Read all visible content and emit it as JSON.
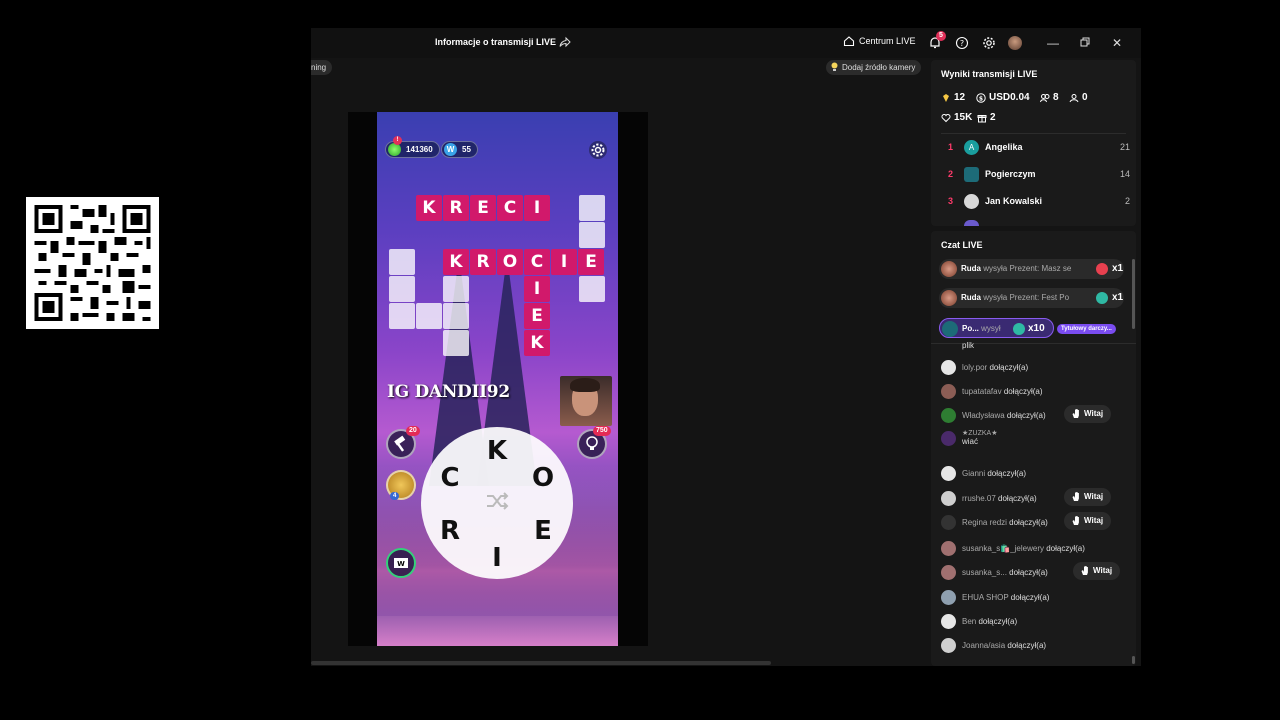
{
  "titlebar": {
    "title": "Informacje o transmisji LIVE",
    "centrum": "Centrum LIVE",
    "notif_count": "5"
  },
  "toolbar": {
    "left_pill": "ning",
    "add_camera": "Dodaj źródło kamery"
  },
  "game": {
    "coins": "141360",
    "w_points": "55",
    "hud_notif": "!",
    "watermark": "IG DANDII92",
    "words": {
      "kreci": [
        "K",
        "R",
        "E",
        "C",
        "I"
      ],
      "krocie": [
        "K",
        "R",
        "O",
        "C",
        "I",
        "E"
      ],
      "vertical": [
        "I",
        "E",
        "K"
      ]
    },
    "hammer_count": "20",
    "hint_count": "750",
    "gift_small": "4",
    "wheel_letters": [
      "K",
      "O",
      "E",
      "I",
      "R",
      "C"
    ]
  },
  "results": {
    "title": "Wyniki transmisji LIVE",
    "diamonds": "12",
    "usd": "USD0.04",
    "viewers": "8",
    "followers": "0",
    "likes": "15K",
    "gifts": "2",
    "ranking": [
      {
        "rank": "1",
        "name": "Angelika",
        "score": "21",
        "initial": "A"
      },
      {
        "rank": "2",
        "name": "Pogierczym",
        "score": "14",
        "initial": ""
      },
      {
        "rank": "3",
        "name": "Jan Kowalski",
        "score": "2",
        "initial": ""
      }
    ]
  },
  "chat": {
    "title": "Czat LIVE",
    "gifts": [
      {
        "user": "Ruda",
        "text": "wysyła Prezent: Masz se",
        "mult": "x1"
      },
      {
        "user": "Ruda",
        "text": "wysyła Prezent: Fest Po",
        "mult": "x1"
      },
      {
        "user": "Po...",
        "text": "wysył",
        "mult": "x10",
        "tag": "Tytułowy darczy..."
      }
    ],
    "messages": [
      {
        "user": "",
        "text": "plik"
      },
      {
        "user": "loly.por",
        "text": "dołączył(a)"
      },
      {
        "user": "tupatatafav",
        "text": "dołączył(a)"
      },
      {
        "user": "Władysława",
        "text": "dołączył(a)",
        "witaj": "Witaj"
      },
      {
        "user": "★ZUZKA★",
        "text": "wiać"
      },
      {
        "user": "Gianni",
        "text": "dołączył(a)"
      },
      {
        "user": "rrushe.07",
        "text": "dołączył(a)",
        "witaj": "Witaj"
      },
      {
        "user": "Regina redzi",
        "text": "dołączył(a)",
        "witaj": "Witaj"
      },
      {
        "user": "susanka_s🛍️_jelewery",
        "text": "dołączył(a)"
      },
      {
        "user": "susanka_s...",
        "text": "dołączył(a)",
        "witaj": "Witaj"
      },
      {
        "user": "EHUA SHOP",
        "text": "dołączył(a)"
      },
      {
        "user": "Ben",
        "text": "dołączył(a)"
      },
      {
        "user": "Joanna/asia",
        "text": "dołączył(a)"
      }
    ]
  },
  "colors": {
    "accent": "#d1196b",
    "rank": "#ff3b6b",
    "badge": "#e2305a"
  }
}
